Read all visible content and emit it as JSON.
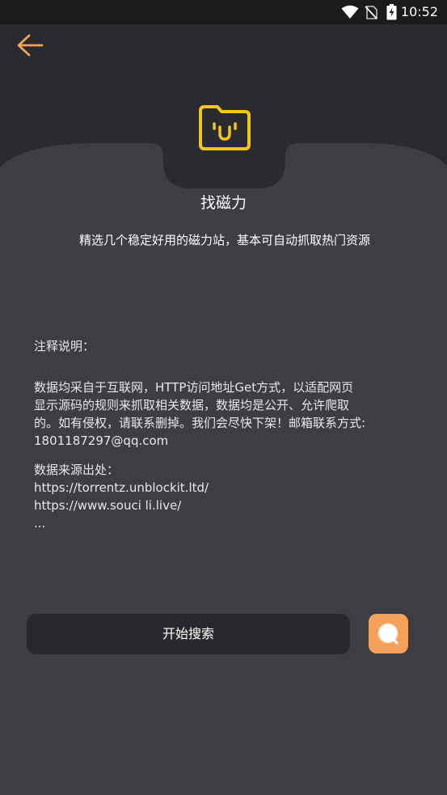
{
  "status_bar": {
    "time": "10:52",
    "icons": [
      "wifi-icon",
      "no-sim-icon",
      "battery-charging-icon"
    ]
  },
  "header": {
    "back_icon": "arrow-left-icon"
  },
  "hero": {
    "icon": "folder-smile-icon",
    "title": "找磁力",
    "subtitle": "精选几个稳定好用的磁力站，基本可自动抓取热门资源"
  },
  "notes": {
    "heading": "注释说明：",
    "body_lines": [
      "数据均采自于互联网，HTTP访问地址Get方式，以适配网页",
      "显示源码的规则来抓取相关数据，数据均是公开、允许爬取",
      "的。如有侵权，请联系删掉。我们会尽快下架！邮箱联系方式:",
      "1801187297@qq.com"
    ],
    "sources_heading": "数据来源出处：",
    "sources": [
      "https://torrentz.unblockit.ltd/",
      "https://www.souci li.live/",
      "..."
    ]
  },
  "actions": {
    "search_label": "开始搜索",
    "search_icon": "search-icon"
  },
  "colors": {
    "accent": "#f6a15a",
    "folder": "#f3c61c",
    "background": "#2a2b2e",
    "card": "#3c3e43",
    "button": "#28292c"
  }
}
